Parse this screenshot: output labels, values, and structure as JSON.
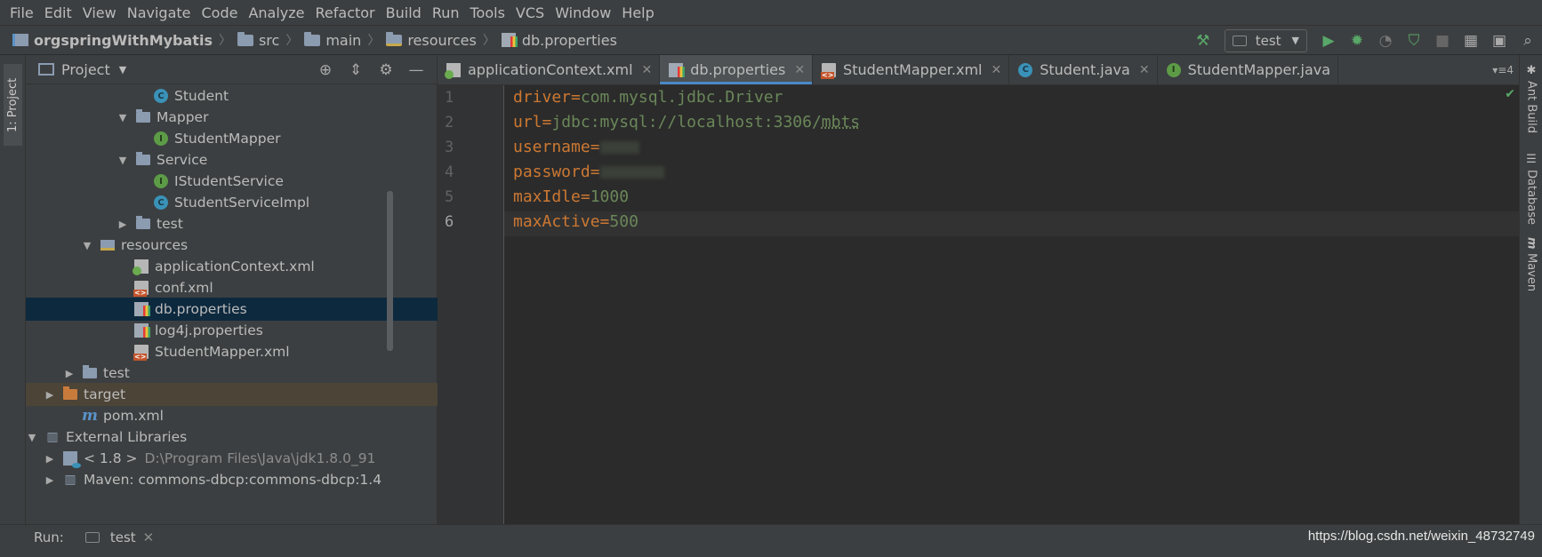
{
  "menu": [
    "File",
    "Edit",
    "View",
    "Navigate",
    "Code",
    "Analyze",
    "Refactor",
    "Build",
    "Run",
    "Tools",
    "VCS",
    "Window",
    "Help"
  ],
  "breadcrumb": {
    "project": "orgspringWithMybatis",
    "items": [
      "src",
      "main",
      "resources",
      "db.properties"
    ]
  },
  "run_config": {
    "name": "test"
  },
  "left_strip": {
    "project_tab": "1: Project"
  },
  "right_strip": [
    "Ant Build",
    "Database",
    "Maven"
  ],
  "project_panel": {
    "title": "Project",
    "tree": [
      {
        "label": "Student",
        "icon": "class"
      },
      {
        "label": "Mapper",
        "icon": "folder"
      },
      {
        "label": "StudentMapper",
        "icon": "interface"
      },
      {
        "label": "Service",
        "icon": "folder"
      },
      {
        "label": "IStudentService",
        "icon": "interface"
      },
      {
        "label": "StudentServiceImpl",
        "icon": "class"
      },
      {
        "label": "test",
        "icon": "folder"
      },
      {
        "label": "resources",
        "icon": "resources"
      },
      {
        "label": "applicationContext.xml",
        "icon": "spring-xml"
      },
      {
        "label": "conf.xml",
        "icon": "xml"
      },
      {
        "label": "db.properties",
        "icon": "properties"
      },
      {
        "label": "log4j.properties",
        "icon": "properties"
      },
      {
        "label": "StudentMapper.xml",
        "icon": "xml"
      },
      {
        "label": "test",
        "icon": "folder"
      },
      {
        "label": "target",
        "icon": "folder-excluded"
      },
      {
        "label": "pom.xml",
        "icon": "maven"
      },
      {
        "label": "External Libraries",
        "icon": "library"
      },
      {
        "label": "< 1.8 >",
        "path": "D:\\Program Files\\Java\\jdk1.8.0_91",
        "icon": "jdk"
      },
      {
        "label": "Maven: commons-dbcp:commons-dbcp:1.4",
        "icon": "library"
      }
    ]
  },
  "tabs": [
    {
      "label": "applicationContext.xml",
      "icon": "spring-xml"
    },
    {
      "label": "db.properties",
      "icon": "properties",
      "active": true
    },
    {
      "label": "StudentMapper.xml",
      "icon": "xml"
    },
    {
      "label": "Student.java",
      "icon": "class"
    },
    {
      "label": "StudentMapper.java",
      "icon": "interface"
    }
  ],
  "tabs_overflow": "4",
  "editor": {
    "lines": [
      {
        "num": "1",
        "key": "driver",
        "value": "com.mysql.jdbc.Driver"
      },
      {
        "num": "2",
        "key": "url",
        "value": "jdbc:mysql://localhost:3306/",
        "value2": "mbts"
      },
      {
        "num": "3",
        "key": "username",
        "value": ""
      },
      {
        "num": "4",
        "key": "password",
        "value": ""
      },
      {
        "num": "5",
        "key": "maxIdle",
        "value": "1000"
      },
      {
        "num": "6",
        "key": "maxActive",
        "value": "500"
      }
    ]
  },
  "run_bar": {
    "label": "Run:",
    "tab": "test",
    "watermark": "https://blog.csdn.net/weixin_48732749"
  },
  "colors": {
    "key": "#cc7832",
    "value": "#6a8759",
    "selection": "#0d293e",
    "accent": "#4a88c7"
  }
}
